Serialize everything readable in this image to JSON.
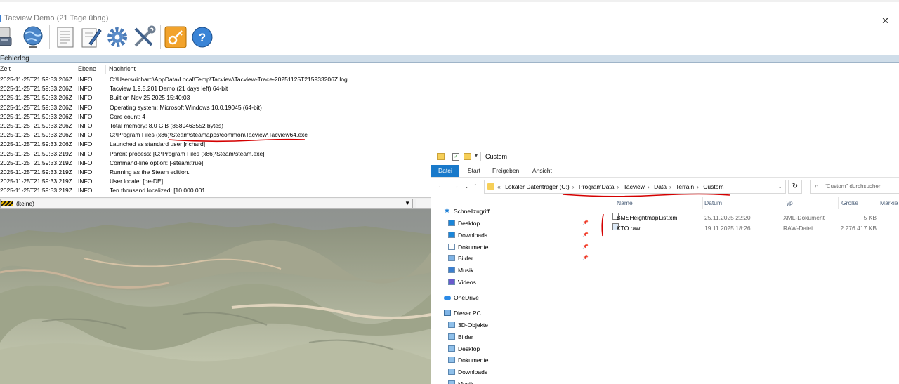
{
  "tacview": {
    "window_title": "Tacview Demo (21 Tage übrig)",
    "toolbar": {
      "buttons": [
        {
          "name": "storage",
          "icon": "usb-drive-icon"
        },
        {
          "name": "globe",
          "icon": "globe-icon"
        },
        {
          "name": "document",
          "icon": "document-icon"
        },
        {
          "name": "edit",
          "icon": "pencil-document-icon"
        },
        {
          "name": "settings",
          "icon": "gear-icon"
        },
        {
          "name": "tools",
          "icon": "wrench-screwdriver-icon"
        },
        {
          "name": "license",
          "icon": "key-icon"
        },
        {
          "name": "help",
          "icon": "help-icon"
        }
      ]
    },
    "error_log": {
      "title": "Fehlerlog",
      "columns": [
        "Zeit",
        "Ebene",
        "Nachricht"
      ],
      "rows": [
        {
          "time": "2025-11-25T21:59:33.206Z",
          "level": "INFO",
          "message": "C:\\Users\\richard\\AppData\\Local\\Temp\\Tacview\\Tacview-Trace-20251125T215933206Z.log"
        },
        {
          "time": "2025-11-25T21:59:33.206Z",
          "level": "INFO",
          "message": "Tacview 1.9.5.201 Demo (21 days left) 64-bit"
        },
        {
          "time": "2025-11-25T21:59:33.206Z",
          "level": "INFO",
          "message": "Built on Nov 25 2025 15:40:03"
        },
        {
          "time": "2025-11-25T21:59:33.206Z",
          "level": "INFO",
          "message": "Operating system: Microsoft Windows 10.0.19045 (64-bit)"
        },
        {
          "time": "2025-11-25T21:59:33.206Z",
          "level": "INFO",
          "message": "Core count: 4"
        },
        {
          "time": "2025-11-25T21:59:33.206Z",
          "level": "INFO",
          "message": "Total memory: 8.0 GiB (8589463552 bytes)"
        },
        {
          "time": "2025-11-25T21:59:33.206Z",
          "level": "INFO",
          "message": "C:\\Program Files (x86)\\Steam\\steamapps\\common\\Tacview\\Tacview64.exe"
        },
        {
          "time": "2025-11-25T21:59:33.206Z",
          "level": "INFO",
          "message": "Launched as standard user [richard]"
        },
        {
          "time": "2025-11-25T21:59:33.219Z",
          "level": "INFO",
          "message": "Parent process: [C:\\Program Files (x86)\\Steam\\steam.exe]"
        },
        {
          "time": "2025-11-25T21:59:33.219Z",
          "level": "INFO",
          "message": "Command-line option: [-steam:true]"
        },
        {
          "time": "2025-11-25T21:59:33.219Z",
          "level": "INFO",
          "message": "Running as the Steam edition."
        },
        {
          "time": "2025-11-25T21:59:33.219Z",
          "level": "INFO",
          "message": "User locale: [de-DE]"
        },
        {
          "time": "2025-11-25T21:59:33.219Z",
          "level": "INFO",
          "message": "Ten thousand localized: [10.000.001"
        }
      ]
    },
    "filter": {
      "selected": "(keine)"
    }
  },
  "explorer": {
    "title": "Custom",
    "ribbon_tabs": [
      "Datei",
      "Start",
      "Freigeben",
      "Ansicht"
    ],
    "breadcrumb": [
      "Lokaler Datenträger (C:)",
      "ProgramData",
      "Tacview",
      "Data",
      "Terrain",
      "Custom"
    ],
    "breadcrumb_overflow": "«",
    "search_placeholder": "\"Custom\" durchsuchen",
    "nav": {
      "quick_access": "Schnellzugriff",
      "quick_items": [
        "Desktop",
        "Downloads",
        "Dokumente",
        "Bilder",
        "Musik",
        "Videos"
      ],
      "onedrive": "OneDrive",
      "this_pc": "Dieser PC",
      "pc_items": [
        "3D-Objekte",
        "Bilder",
        "Desktop",
        "Dokumente",
        "Downloads",
        "Musik"
      ]
    },
    "columns": [
      "Name",
      "Datum",
      "Typ",
      "Größe",
      "Markie"
    ],
    "files": [
      {
        "name": "BMSHeightmapList.xml",
        "date": "25.11.2025 22:20",
        "type": "XML-Dokument",
        "size": "5 KB"
      },
      {
        "name": "KTO.raw",
        "date": "19.11.2025 18:26",
        "type": "RAW-Datei",
        "size": "2.276.417 KB"
      }
    ]
  },
  "colors": {
    "accent": "#1979ca",
    "annotation": "#d40000",
    "log_header": "#cfdde9"
  }
}
